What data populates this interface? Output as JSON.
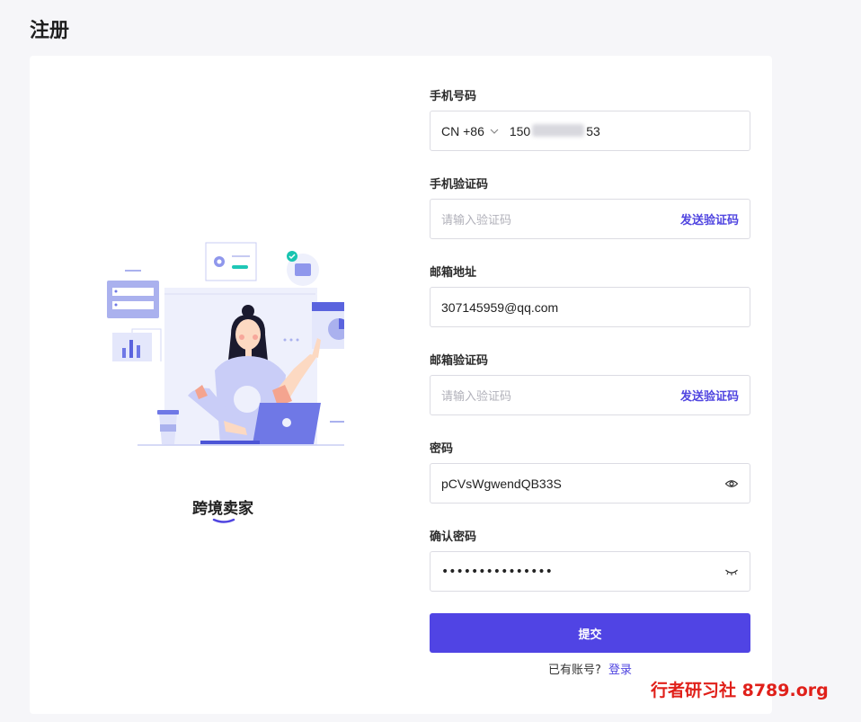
{
  "page": {
    "title": "注册"
  },
  "left": {
    "role_label": "跨境卖家"
  },
  "form": {
    "phone": {
      "label": "手机号码",
      "country_code": "CN +86",
      "value_start": "150",
      "value_end": "53"
    },
    "phone_code": {
      "label": "手机验证码",
      "placeholder": "请输入验证码",
      "send_label": "发送验证码"
    },
    "email": {
      "label": "邮箱地址",
      "value": "307145959@qq.com"
    },
    "email_code": {
      "label": "邮箱验证码",
      "placeholder": "请输入验证码",
      "send_label": "发送验证码"
    },
    "password": {
      "label": "密码",
      "value": "pCVsWgwendQB33S"
    },
    "confirm_password": {
      "label": "确认密码",
      "masked_value": "•••••••••••••••"
    },
    "submit_label": "提交",
    "have_account_text": "已有账号?",
    "login_label": "登录"
  },
  "watermark": "行者研习社 8789.org",
  "colors": {
    "accent": "#5044e4",
    "background": "#f6f6f9",
    "watermark": "#e0201a"
  }
}
